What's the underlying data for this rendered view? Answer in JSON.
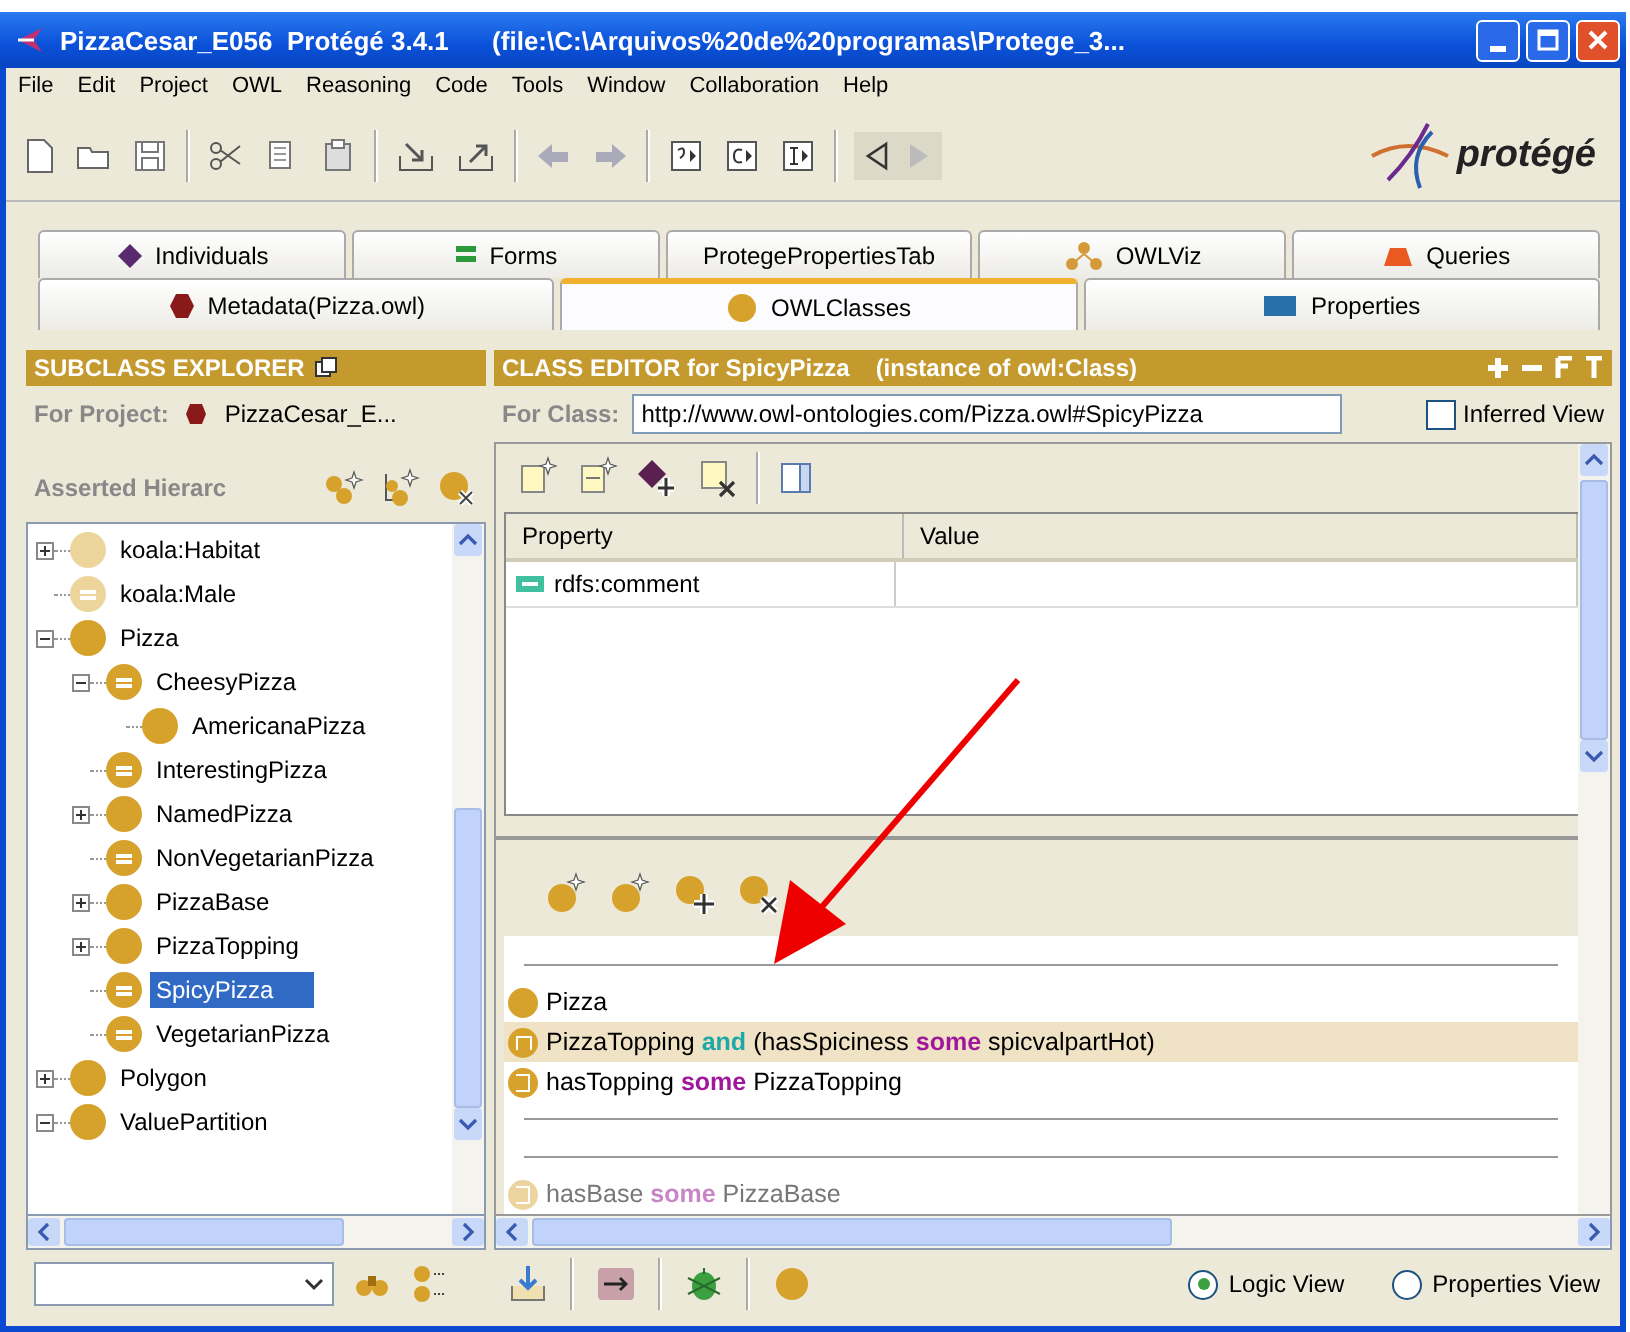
{
  "window": {
    "title": "PizzaCesar_E056  Protégé 3.4.1      (file:\\C:\\Arquivos%20de%20programas\\Protege_3..."
  },
  "menu": [
    "File",
    "Edit",
    "Project",
    "OWL",
    "Reasoning",
    "Code",
    "Tools",
    "Window",
    "Collaboration",
    "Help"
  ],
  "logo": "protégé",
  "tabs_row1": [
    {
      "label": "Individuals",
      "selected": false
    },
    {
      "label": "Forms",
      "selected": false
    },
    {
      "label": "ProtegePropertiesTab",
      "selected": false
    },
    {
      "label": "OWLViz",
      "selected": false
    },
    {
      "label": "Queries",
      "selected": false
    }
  ],
  "tabs_row2": [
    {
      "label": "Metadata(Pizza.owl)",
      "selected": false
    },
    {
      "label": "OWLClasses",
      "selected": true
    },
    {
      "label": "Properties",
      "selected": false
    }
  ],
  "subclass_explorer": {
    "title": "SUBCLASS EXPLORER",
    "project_label": "For Project:",
    "project_value": "PizzaCesar_E...",
    "hierarchy_label": "Asserted Hierarc",
    "tree": [
      {
        "label": "koala:Habitat",
        "kind": "primitive",
        "imported": true,
        "expanded": false,
        "selected": false
      },
      {
        "label": "koala:Male",
        "kind": "defined",
        "imported": true,
        "selected": false
      },
      {
        "label": "Pizza",
        "kind": "primitive",
        "imported": false,
        "expanded": true,
        "selected": false,
        "children": [
          {
            "label": "CheesyPizza",
            "kind": "defined",
            "imported": false,
            "expanded": true,
            "selected": false,
            "children": [
              {
                "label": "AmericanaPizza",
                "kind": "primitive",
                "imported": false,
                "selected": false
              }
            ]
          },
          {
            "label": "InterestingPizza",
            "kind": "defined",
            "imported": false,
            "selected": false
          },
          {
            "label": "NamedPizza",
            "kind": "primitive",
            "imported": false,
            "expanded": false,
            "selected": false
          },
          {
            "label": "NonVegetarianPizza",
            "kind": "defined",
            "imported": false,
            "selected": false
          },
          {
            "label": "PizzaBase",
            "kind": "primitive",
            "imported": false,
            "expanded": false,
            "selected": false
          },
          {
            "label": "PizzaTopping",
            "kind": "primitive",
            "imported": false,
            "expanded": false,
            "selected": false
          },
          {
            "label": "SpicyPizza",
            "kind": "defined",
            "imported": false,
            "selected": true
          },
          {
            "label": "VegetarianPizza",
            "kind": "defined",
            "imported": false,
            "selected": false
          }
        ]
      },
      {
        "label": "Polygon",
        "kind": "primitive",
        "imported": false,
        "expanded": false,
        "selected": false
      },
      {
        "label": "ValuePartition",
        "kind": "primitive",
        "imported": false,
        "expanded": true,
        "selected": false
      }
    ]
  },
  "class_editor": {
    "title": "CLASS EDITOR for SpicyPizza",
    "subtitle": "(instance of owl:Class)",
    "class_label": "For Class:",
    "class_value": "http://www.owl-ontologies.com/Pizza.owl#SpicyPizza",
    "inferred_view": {
      "label": "Inferred View",
      "checked": false
    },
    "columns": [
      "Property",
      "Value"
    ],
    "rows": [
      {
        "property": "rdfs:comment"
      }
    ],
    "conditions": [
      {
        "kind": "separator"
      },
      {
        "kind": "named",
        "inherited": false,
        "selected": false,
        "parts": [
          {
            "text": "Pizza"
          }
        ]
      },
      {
        "kind": "intersection",
        "inherited": false,
        "selected": true,
        "parts": [
          {
            "text": "PizzaTopping"
          },
          {
            "text": "and",
            "color": "#1fa8a8"
          },
          {
            "text": "(hasSpiciness"
          },
          {
            "text": "some",
            "color": "#a0169c"
          },
          {
            "text": "spicvalpartHot)"
          }
        ]
      },
      {
        "kind": "some",
        "inherited": false,
        "selected": false,
        "parts": [
          {
            "text": "hasTopping"
          },
          {
            "text": "some",
            "color": "#a0169c"
          },
          {
            "text": "PizzaTopping"
          }
        ]
      },
      {
        "kind": "separator"
      },
      {
        "kind": "separator"
      },
      {
        "kind": "some",
        "inherited": true,
        "selected": false,
        "parts": [
          {
            "text": "hasBase"
          },
          {
            "text": "some",
            "color": "#c986c6"
          },
          {
            "text": "PizzaBase"
          }
        ]
      }
    ],
    "views": [
      {
        "label": "Logic View",
        "selected": true
      },
      {
        "label": "Properties View",
        "selected": false
      }
    ]
  }
}
